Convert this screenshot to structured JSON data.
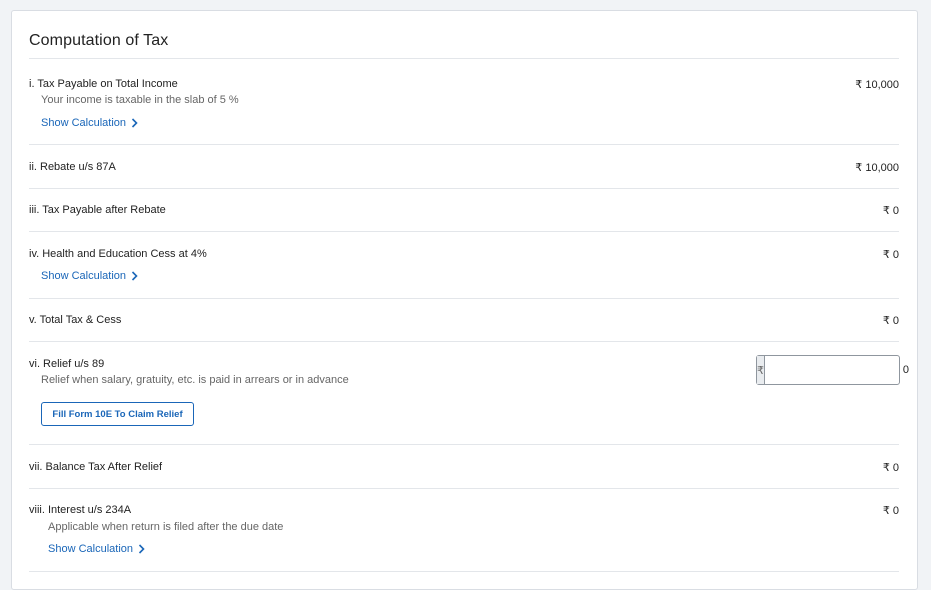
{
  "title": "Computation of Tax",
  "rows": [
    {
      "label": "i. Tax Payable on Total Income",
      "sub": "Your income is taxable in the slab of 5 %",
      "link": "Show Calculation",
      "amount": "₹ 10,000"
    },
    {
      "label": "ii. Rebate u/s 87A",
      "amount": "₹ 10,000"
    },
    {
      "label": "iii. Tax Payable after Rebate",
      "amount": "₹ 0"
    },
    {
      "label": "iv. Health and Education Cess at 4%",
      "link": "Show Calculation",
      "amount": "₹ 0"
    },
    {
      "label": "v. Total Tax & Cess",
      "amount": "₹ 0"
    },
    {
      "label": "vi. Relief u/s 89",
      "sub": "Relief when salary, gratuity, etc. is paid in arrears or in advance",
      "currency_prefix": "₹",
      "input_value": "0",
      "button": "Fill Form 10E To Claim Relief"
    },
    {
      "label": "vii. Balance Tax After Relief",
      "amount": "₹ 0"
    },
    {
      "label": "viii. Interest u/s 234A",
      "sub": "Applicable when return is filed after the due date",
      "link": "Show Calculation",
      "amount": "₹ 0"
    }
  ],
  "icons": {
    "link_chevron": "chevron-right-icon"
  },
  "colors": {
    "link": "#1a66b8",
    "divider": "#e3e6ea",
    "border": "#8f969e"
  }
}
